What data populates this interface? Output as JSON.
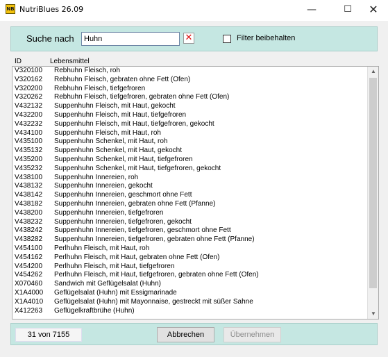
{
  "window": {
    "title": "NutriBlues 26.09",
    "icon_text": "NB",
    "minimize_glyph": "—",
    "maximize_glyph": "☐",
    "close_glyph": "✕"
  },
  "search": {
    "label": "Suche nach",
    "value": "Huhn",
    "clear_glyph": "✕",
    "checkbox_label": "Filter beibehalten",
    "checkbox_checked": false
  },
  "table": {
    "columns": [
      "ID",
      "Lebensmittel"
    ],
    "rows": [
      {
        "id": "V320100",
        "name": "Rebhuhn Fleisch, roh"
      },
      {
        "id": "V320162",
        "name": "Rebhuhn Fleisch, gebraten ohne Fett (Ofen)"
      },
      {
        "id": "V320200",
        "name": "Rebhuhn Fleisch, tiefgefroren"
      },
      {
        "id": "V320262",
        "name": "Rebhuhn Fleisch, tiefgefroren, gebraten ohne Fett (Ofen)"
      },
      {
        "id": "V432132",
        "name": "Suppenhuhn Fleisch, mit Haut, gekocht"
      },
      {
        "id": "V432200",
        "name": "Suppenhuhn Fleisch, mit Haut, tiefgefroren"
      },
      {
        "id": "V432232",
        "name": "Suppenhuhn Fleisch, mit Haut, tiefgefroren, gekocht"
      },
      {
        "id": "V434100",
        "name": "Suppenhuhn Fleisch, mit Haut, roh"
      },
      {
        "id": "V435100",
        "name": "Suppenhuhn Schenkel, mit Haut, roh"
      },
      {
        "id": "V435132",
        "name": "Suppenhuhn Schenkel, mit Haut, gekocht"
      },
      {
        "id": "V435200",
        "name": "Suppenhuhn Schenkel, mit Haut, tiefgefroren"
      },
      {
        "id": "V435232",
        "name": "Suppenhuhn Schenkel, mit Haut, tiefgefroren, gekocht"
      },
      {
        "id": "V438100",
        "name": "Suppenhuhn Innereien, roh"
      },
      {
        "id": "V438132",
        "name": "Suppenhuhn Innereien, gekocht"
      },
      {
        "id": "V438142",
        "name": "Suppenhuhn Innereien, geschmort ohne Fett"
      },
      {
        "id": "V438182",
        "name": "Suppenhuhn Innereien, gebraten ohne Fett (Pfanne)"
      },
      {
        "id": "V438200",
        "name": "Suppenhuhn Innereien, tiefgefroren"
      },
      {
        "id": "V438232",
        "name": "Suppenhuhn Innereien, tiefgefroren, gekocht"
      },
      {
        "id": "V438242",
        "name": "Suppenhuhn Innereien, tiefgefroren, geschmort ohne Fett"
      },
      {
        "id": "V438282",
        "name": "Suppenhuhn Innereien, tiefgefroren, gebraten ohne Fett (Pfanne)"
      },
      {
        "id": "V454100",
        "name": "Perlhuhn Fleisch, mit Haut, roh"
      },
      {
        "id": "V454162",
        "name": "Perlhuhn Fleisch, mit Haut, gebraten ohne Fett (Ofen)"
      },
      {
        "id": "V454200",
        "name": "Perlhuhn Fleisch, mit Haut, tiefgefroren"
      },
      {
        "id": "V454262",
        "name": "Perlhuhn Fleisch, mit Haut, tiefgefroren, gebraten ohne Fett (Ofen)"
      },
      {
        "id": "X070460",
        "name": "Sandwich mit Geflügelsalat (Huhn)"
      },
      {
        "id": "X1A4000",
        "name": "Geflügelsalat (Huhn) mit Essigmarinade"
      },
      {
        "id": "X1A4010",
        "name": "Geflügelsalat (Huhn) mit Mayonnaise, gestreckt mit süßer Sahne"
      },
      {
        "id": "X412263",
        "name": "Geflügelkraftbrühe (Huhn)"
      }
    ]
  },
  "scrollbar": {
    "up_glyph": "▲",
    "down_glyph": "▼"
  },
  "footer": {
    "count_text": "31 von 7155",
    "cancel_label": "Abbrechen",
    "apply_label": "Übernehmen",
    "apply_enabled": false
  },
  "colors": {
    "panel": "#c5e7e2",
    "clear_icon": "#dd1111",
    "disabled_text": "#8d8d8d"
  }
}
